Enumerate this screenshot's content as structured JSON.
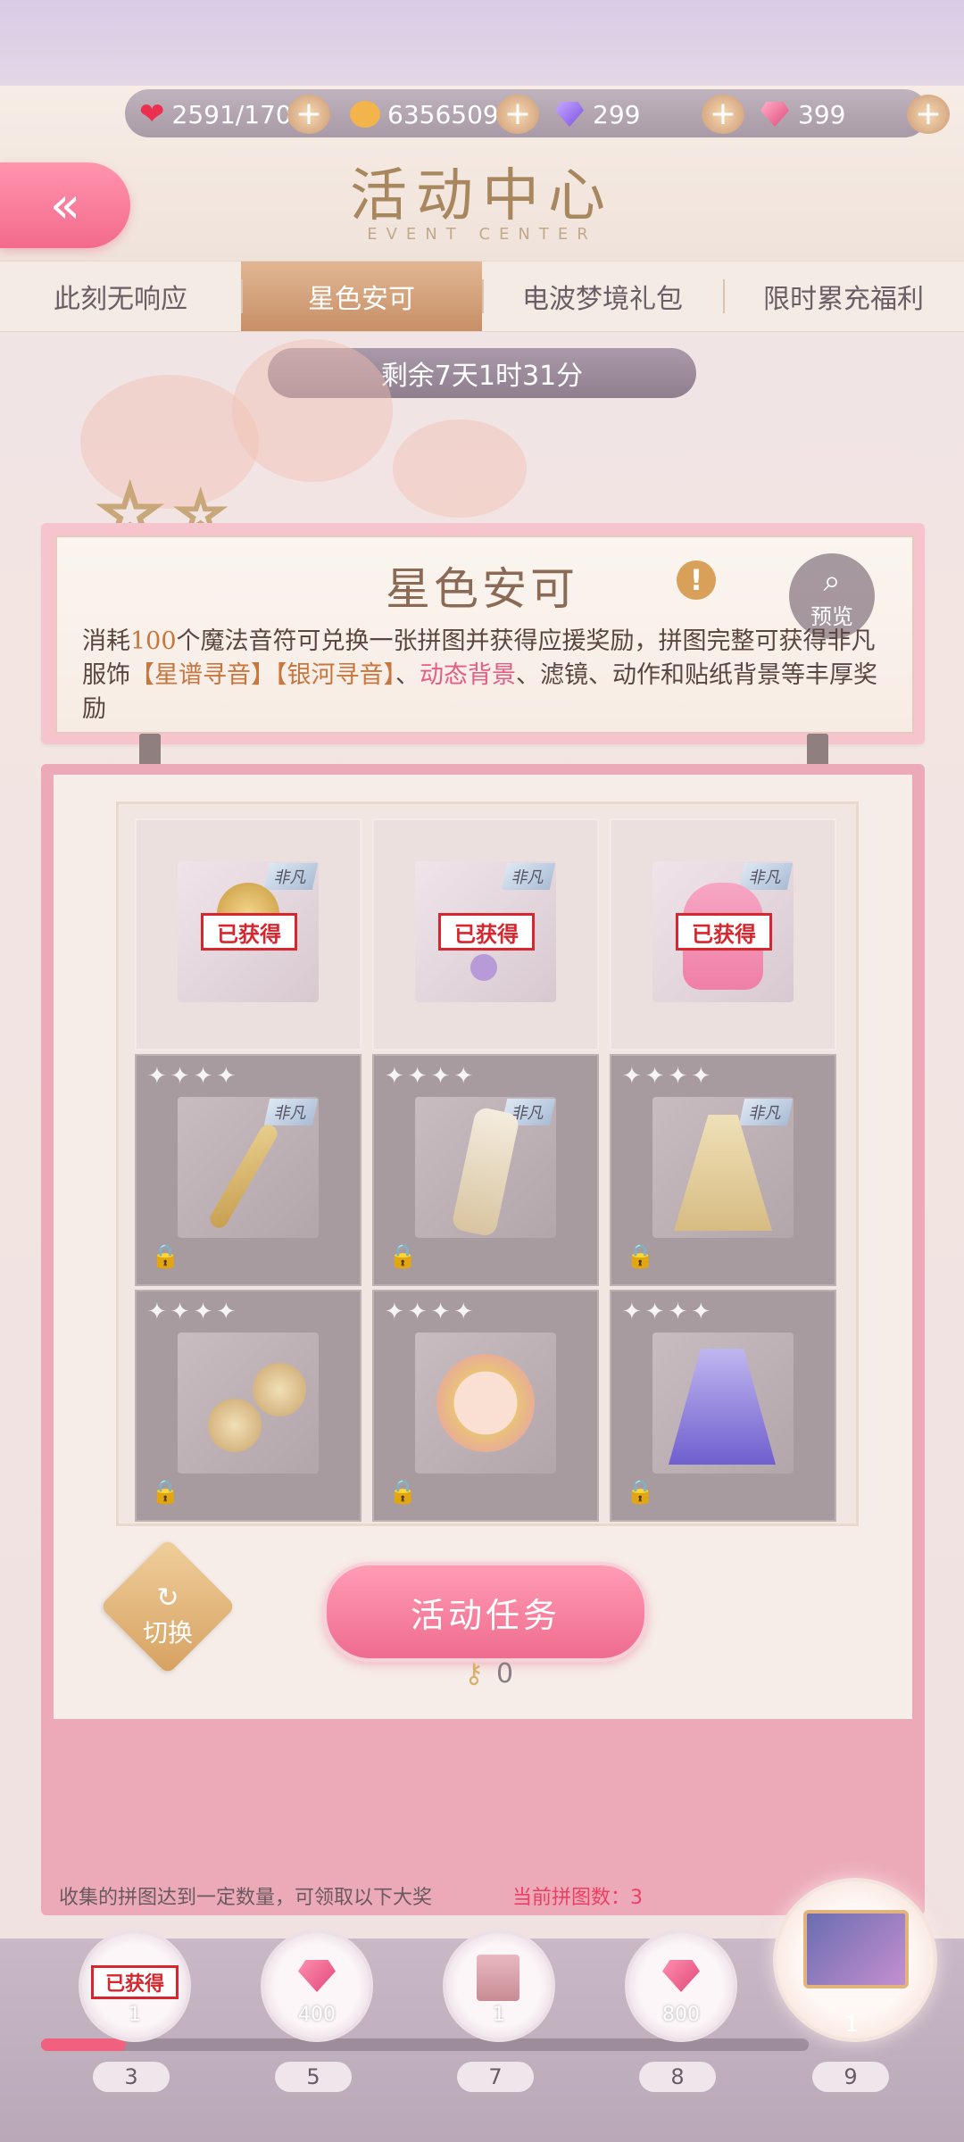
{
  "resources": [
    {
      "icon": "heart-icon",
      "value": "2591/170"
    },
    {
      "icon": "coin-icon",
      "value": "63565093"
    },
    {
      "icon": "diamond-icon",
      "value": "299"
    },
    {
      "icon": "pink-diamond-icon",
      "value": "399"
    }
  ],
  "header": {
    "title": "活动中心",
    "subtitle": "EVENT CENTER",
    "back_icon": "double-chevron-left-icon"
  },
  "tabs": [
    {
      "label": "此刻无响应",
      "active": false
    },
    {
      "label": "星色安可",
      "active": true
    },
    {
      "label": "电波梦境礼包",
      "active": false
    },
    {
      "label": "限时累充福利",
      "active": false
    }
  ],
  "timer": "剩余7天1时31分",
  "card": {
    "title": "星色安可",
    "preview_label": "预览",
    "desc_1": "消耗",
    "desc_num": "100",
    "desc_2": "个魔法音符可兑换一张拼图并获得应援奖励，拼图完整可获得非凡服饰",
    "desc_item_1": "【星谱寻音】",
    "desc_item_2": "【银河寻音】",
    "desc_3": "、",
    "desc_dyn": "动态背景",
    "desc_4": "、滤镜、动作和贴纸背景等丰厚奖励"
  },
  "puzzle": {
    "stamp_label": "已获得",
    "rarity_label": "非凡",
    "cells": [
      {
        "state": "obtained",
        "item": "gold-star-accessory"
      },
      {
        "state": "obtained",
        "item": "purple-earring"
      },
      {
        "state": "obtained",
        "item": "pink-hair"
      },
      {
        "state": "locked",
        "item": "gold-wand"
      },
      {
        "state": "locked",
        "item": "white-boots"
      },
      {
        "state": "locked",
        "item": "gold-dress"
      },
      {
        "state": "locked",
        "item": "gold-earrings"
      },
      {
        "state": "locked",
        "item": "makeup-face"
      },
      {
        "state": "locked",
        "item": "purple-dress"
      }
    ]
  },
  "switch_label": "切换",
  "task_button": "活动任务",
  "key_count": "0",
  "collect_text": "收集的拼图达到一定数量，可领取以下大奖",
  "current_count": "当前拼图数：3",
  "rewards": [
    {
      "milestone": "3",
      "count": "1",
      "type": "obtained",
      "stamp": "已获得"
    },
    {
      "milestone": "5",
      "count": "400",
      "type": "gem"
    },
    {
      "milestone": "7",
      "count": "1",
      "type": "avatar"
    },
    {
      "milestone": "8",
      "count": "800",
      "type": "gem"
    },
    {
      "milestone": "9",
      "count": "1",
      "type": "chest"
    }
  ],
  "progress": 0.11
}
